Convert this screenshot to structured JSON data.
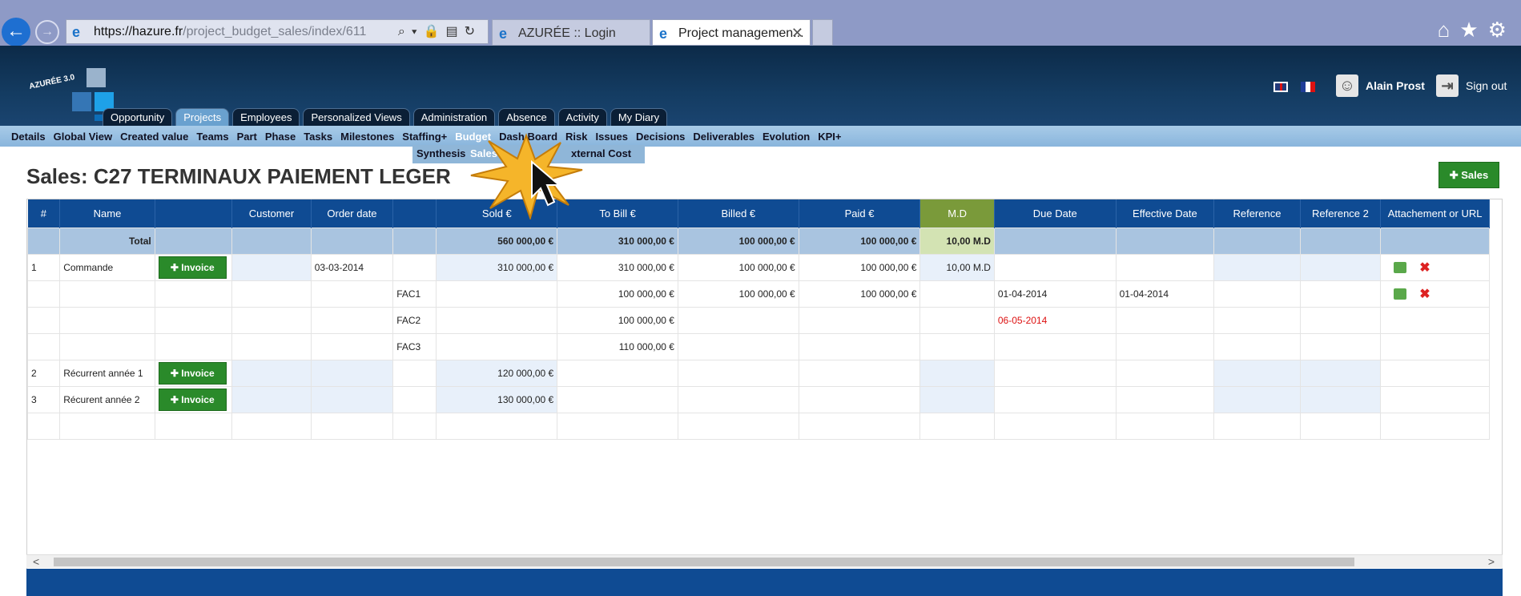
{
  "browser": {
    "url_host": "https://hazure.fr",
    "url_path": "/project_budget_sales/index/611",
    "tabs": [
      {
        "label": "AZURÉE :: Login"
      },
      {
        "label": "Project managemen..."
      }
    ]
  },
  "header": {
    "logo_text": "AZURÉE 3.0",
    "user_name": "Alain Prost",
    "sign_out": "Sign out"
  },
  "main_tabs": [
    {
      "label": "Opportunity"
    },
    {
      "label": "Projects"
    },
    {
      "label": "Employees"
    },
    {
      "label": "Personalized Views"
    },
    {
      "label": "Administration"
    },
    {
      "label": "Absence"
    },
    {
      "label": "Activity"
    },
    {
      "label": "My Diary"
    }
  ],
  "subnav": [
    {
      "label": "Details"
    },
    {
      "label": "Global View"
    },
    {
      "label": "Created value"
    },
    {
      "label": "Teams"
    },
    {
      "label": "Part"
    },
    {
      "label": "Phase"
    },
    {
      "label": "Tasks"
    },
    {
      "label": "Milestones"
    },
    {
      "label": "Staffing+"
    },
    {
      "label": "Budget"
    },
    {
      "label": "Dash Board"
    },
    {
      "label": "Risk"
    },
    {
      "label": "Issues"
    },
    {
      "label": "Decisions"
    },
    {
      "label": "Deliverables"
    },
    {
      "label": "Evolution"
    },
    {
      "label": "KPI+"
    }
  ],
  "submenu": {
    "synthesis": "Synthesis",
    "sales": "Sales",
    "external_cost": "xternal Cost"
  },
  "page": {
    "title": "Sales: C27 TERMINAUX PAIEMENT LEGER",
    "sales_button": "Sales"
  },
  "table": {
    "headers": [
      "#",
      "Name",
      "",
      "Customer",
      "Order date",
      "",
      "Sold €",
      "To Bill €",
      "Billed €",
      "Paid €",
      "M.D",
      "Due Date",
      "Effective Date",
      "Reference",
      "Reference 2",
      "Attachement or URL"
    ],
    "total": {
      "label": "Total",
      "sold": "560 000,00 €",
      "to_bill": "310 000,00 €",
      "billed": "100 000,00 €",
      "paid": "100 000,00 €",
      "md": "10,00 M.D"
    },
    "invoice_label": "Invoice",
    "rows": [
      {
        "num": "1",
        "name": "Commande",
        "order_date": "03-03-2014",
        "sub": "",
        "sold": "310 000,00 €",
        "to_bill": "310 000,00 €",
        "billed": "100 000,00 €",
        "paid": "100 000,00 €",
        "md": "10,00 M.D",
        "due": "",
        "effective": ""
      },
      {
        "num": "",
        "name": "",
        "order_date": "",
        "sub": "FAC1",
        "sold": "",
        "to_bill": "100 000,00 €",
        "billed": "100 000,00 €",
        "paid": "100 000,00 €",
        "md": "",
        "due": "01-04-2014",
        "effective": "01-04-2014"
      },
      {
        "num": "",
        "name": "",
        "order_date": "",
        "sub": "FAC2",
        "sold": "",
        "to_bill": "100 000,00 €",
        "billed": "",
        "paid": "",
        "md": "",
        "due": "06-05-2014",
        "effective": ""
      },
      {
        "num": "",
        "name": "",
        "order_date": "",
        "sub": "FAC3",
        "sold": "",
        "to_bill": "110 000,00 €",
        "billed": "",
        "paid": "",
        "md": "",
        "due": "",
        "effective": ""
      },
      {
        "num": "2",
        "name": "Récurrent année 1",
        "order_date": "",
        "sub": "",
        "sold": "120 000,00 €",
        "to_bill": "",
        "billed": "",
        "paid": "",
        "md": "",
        "due": "",
        "effective": ""
      },
      {
        "num": "3",
        "name": "Récurent année 2",
        "order_date": "",
        "sub": "",
        "sold": "130 000,00 €",
        "to_bill": "",
        "billed": "",
        "paid": "",
        "md": "",
        "due": "",
        "effective": ""
      }
    ]
  },
  "colors": {
    "header_blue": "#0f4b93",
    "button_green": "#2a8a2a",
    "md_header": "#7a9a3a",
    "overdue": "#dd1111"
  }
}
